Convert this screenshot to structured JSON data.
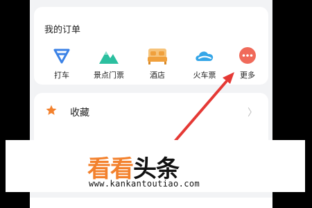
{
  "orders": {
    "title": "我的订单",
    "items": [
      {
        "label": "打车",
        "icon": "taxi-icon"
      },
      {
        "label": "景点门票",
        "icon": "mountain-icon"
      },
      {
        "label": "酒店",
        "icon": "hotel-bed-icon"
      },
      {
        "label": "火车票",
        "icon": "train-cloud-icon"
      },
      {
        "label": "更多",
        "icon": "more-dots-icon"
      }
    ]
  },
  "favorites": {
    "label": "收藏",
    "icon": "star-icon",
    "chevron": "〉"
  },
  "watermark": {
    "logo_orange": "看看",
    "logo_black": "头条",
    "url": "www.kankantoutiao.com"
  },
  "colors": {
    "accent_orange": "#f3812d",
    "taxi_blue": "#3b82e6",
    "mountain_teal": "#2bbf9f",
    "hotel_orange": "#f0a03c",
    "train_sky": "#35a6e8",
    "more_red": "#f06a5a",
    "arrow_red": "#e53935"
  }
}
